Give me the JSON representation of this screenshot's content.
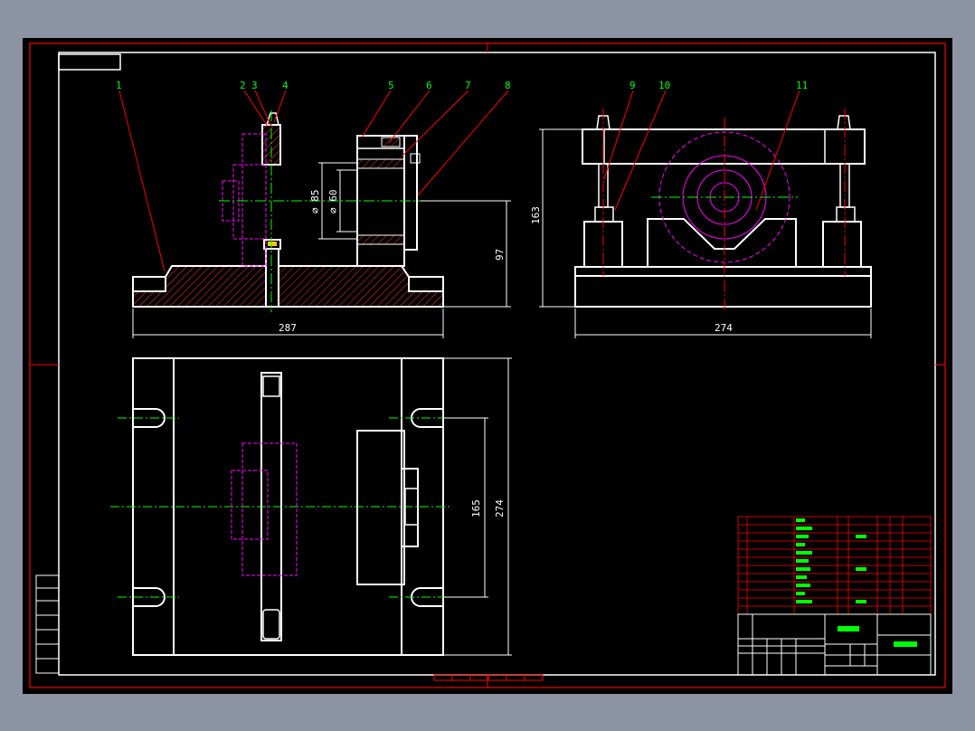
{
  "colors": {
    "background": "#000000",
    "outer_frame": "#ff0000",
    "outline": "#ffffff",
    "centerline": "#00ff00",
    "hidden": "#ff00ff",
    "balloon": "#ff0000",
    "hatch": "#ff3333"
  },
  "balloons": [
    "1",
    "2",
    "3",
    "4",
    "5",
    "6",
    "7",
    "8",
    "9",
    "10",
    "11"
  ],
  "dimensions": {
    "base_length": "287",
    "right_width": "274",
    "height_right": "163",
    "axis_height": "97",
    "dia_outer": "∅ 85",
    "dia_inner": "∅ 60",
    "slot_spacing": "165",
    "plate_width": "274"
  }
}
